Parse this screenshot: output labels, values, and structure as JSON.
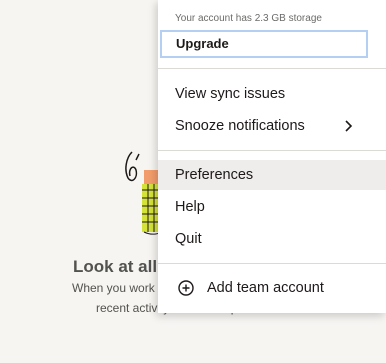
{
  "background": {
    "empty_title": "Look at all",
    "empty_line1": "When you work",
    "empty_line2": "recent activity will show up here."
  },
  "menu": {
    "storage_text": "Your account has 2.3 GB storage",
    "upgrade_label": "Upgrade",
    "items": [
      {
        "label": "View sync issues"
      },
      {
        "label": "Snooze notifications"
      },
      {
        "label": "Preferences"
      },
      {
        "label": "Help"
      },
      {
        "label": "Quit"
      },
      {
        "label": "Add team account"
      }
    ]
  },
  "colors": {
    "upgrade_border": "#b5cff2",
    "hover_highlight": "#efedeb",
    "illustration_yellow": "#d4e23a",
    "illustration_orange": "#f29c6b"
  },
  "icons": {
    "submenu": "chevron-right-icon",
    "add": "plus-circle-icon"
  }
}
